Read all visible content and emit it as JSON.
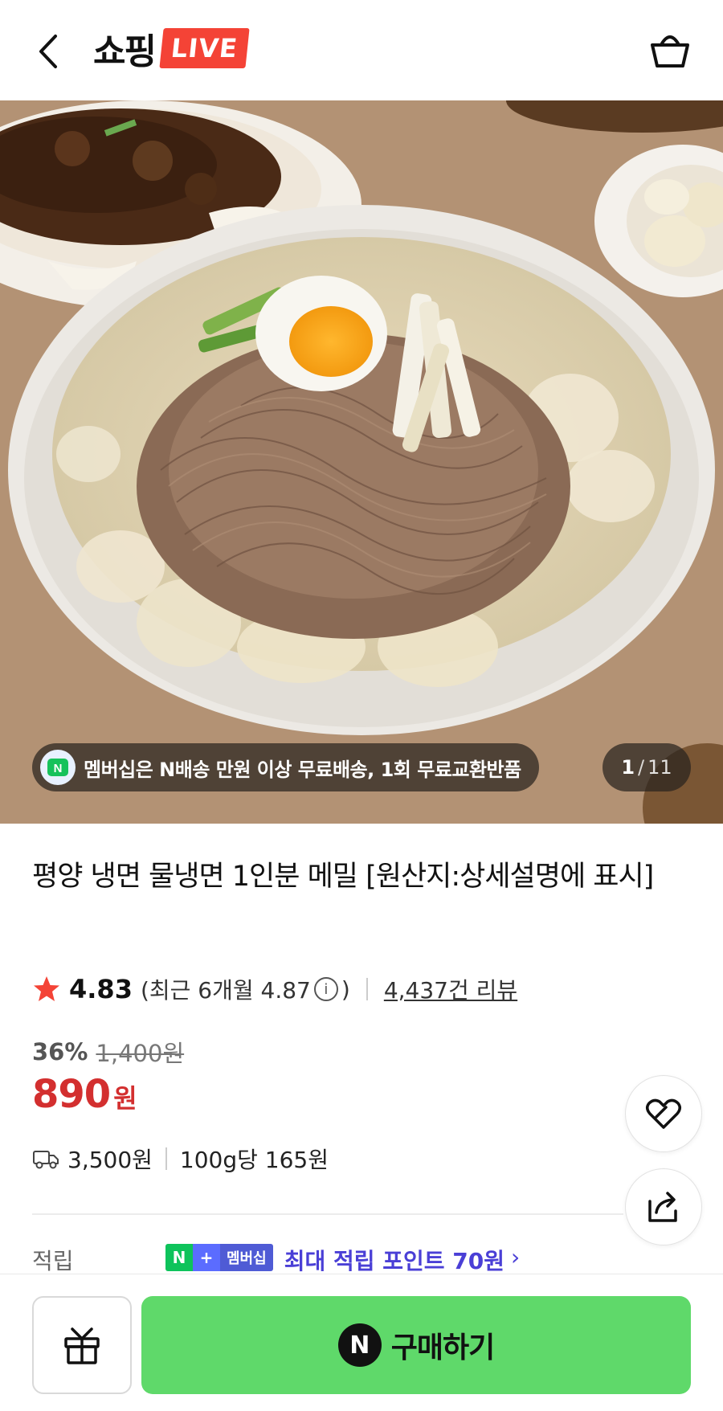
{
  "header": {
    "logo_text": "쇼핑",
    "logo_badge": "LIVE"
  },
  "hero": {
    "promo_text": "멤버십은 N배송 만원 이상 무료배송, 1회 무료교환반품",
    "promo_icon_letter": "N",
    "page_current": "1",
    "page_sep": "/",
    "page_total": "11"
  },
  "product": {
    "title": "평양 냉면 물냉면 1인분 메밀 [원산지:상세설명에 표시]",
    "rating": "4.83",
    "recent_rating_prefix": "(최근 6개월 4.87",
    "recent_rating_suffix": ")",
    "info_icon": "i",
    "review_count": "4,437건 리뷰",
    "discount": "36%",
    "original_price": "1,400원",
    "price": "890",
    "currency": "원",
    "shipping_fee": "3,500원",
    "unit_price": "100g당 165원"
  },
  "points": {
    "label": "적립",
    "badge_n": "N",
    "badge_plus": "+",
    "badge_member": "멤버십",
    "text": "최대 적립 포인트 70원",
    "arrow": "›"
  },
  "bottom": {
    "buy_icon_letter": "N",
    "buy_label": "구매하기"
  },
  "colors": {
    "live_red": "#f44336",
    "price_red": "#d32f2f",
    "buy_green": "#5fd96a",
    "points_purple": "#4a3fd6"
  },
  "icons": {
    "back": "chevron-left-icon",
    "cart": "shopping-bag-icon",
    "star": "star-icon",
    "truck": "delivery-truck-icon",
    "favorite": "heart-icon",
    "share": "share-icon",
    "gift": "gift-icon"
  }
}
